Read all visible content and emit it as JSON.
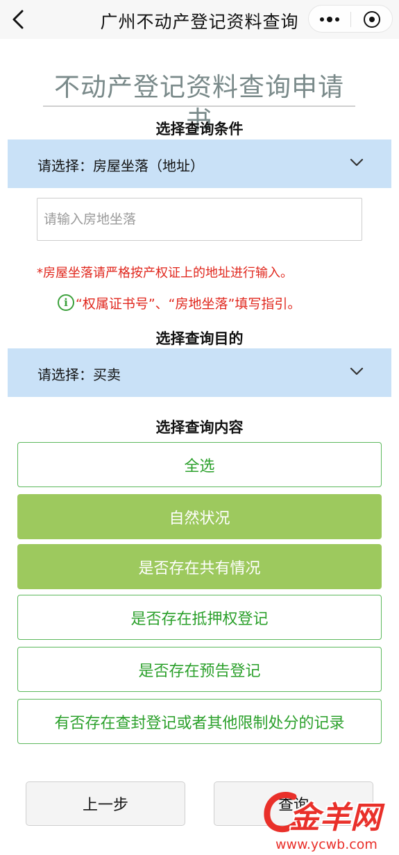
{
  "navbar": {
    "title": "广州不动产登记资料查询",
    "back_icon": "chevron-left-icon",
    "more_icon": "more-dots-icon",
    "close_icon": "target-icon"
  },
  "page": {
    "title": "不动产登记资料查询申请书"
  },
  "condition": {
    "section_title": "选择查询条件",
    "select_value": "请选择：房屋坐落（地址）",
    "input_placeholder": "请输入房地坐落",
    "input_value": "",
    "warning": "*房屋坐落请严格按产权证上的地址进行输入。",
    "guide_text": "“权属证书号”、“房地坐落”填写指引。"
  },
  "purpose": {
    "section_title": "选择查询目的",
    "select_value": "请选择：买卖"
  },
  "content": {
    "section_title": "选择查询内容",
    "options": [
      {
        "label": "全选",
        "selected": false
      },
      {
        "label": "自然状况",
        "selected": true
      },
      {
        "label": "是否存在共有情况",
        "selected": true
      },
      {
        "label": "是否存在抵押权登记",
        "selected": false
      },
      {
        "label": "是否存在预告登记",
        "selected": false
      },
      {
        "label": "有否存在查封登记或者其他限制处分的记录",
        "selected": false
      }
    ]
  },
  "actions": {
    "prev_label": "上一步",
    "query_label": "查询"
  },
  "watermark": {
    "logo_text": "金羊网",
    "url": "www.ycwb.com"
  },
  "colors": {
    "select_bg": "#c9e1f7",
    "option_border": "#5cb85c",
    "option_selected_bg": "#9dc95e",
    "warning_red": "#e0261c",
    "info_green": "#3aa03a"
  }
}
